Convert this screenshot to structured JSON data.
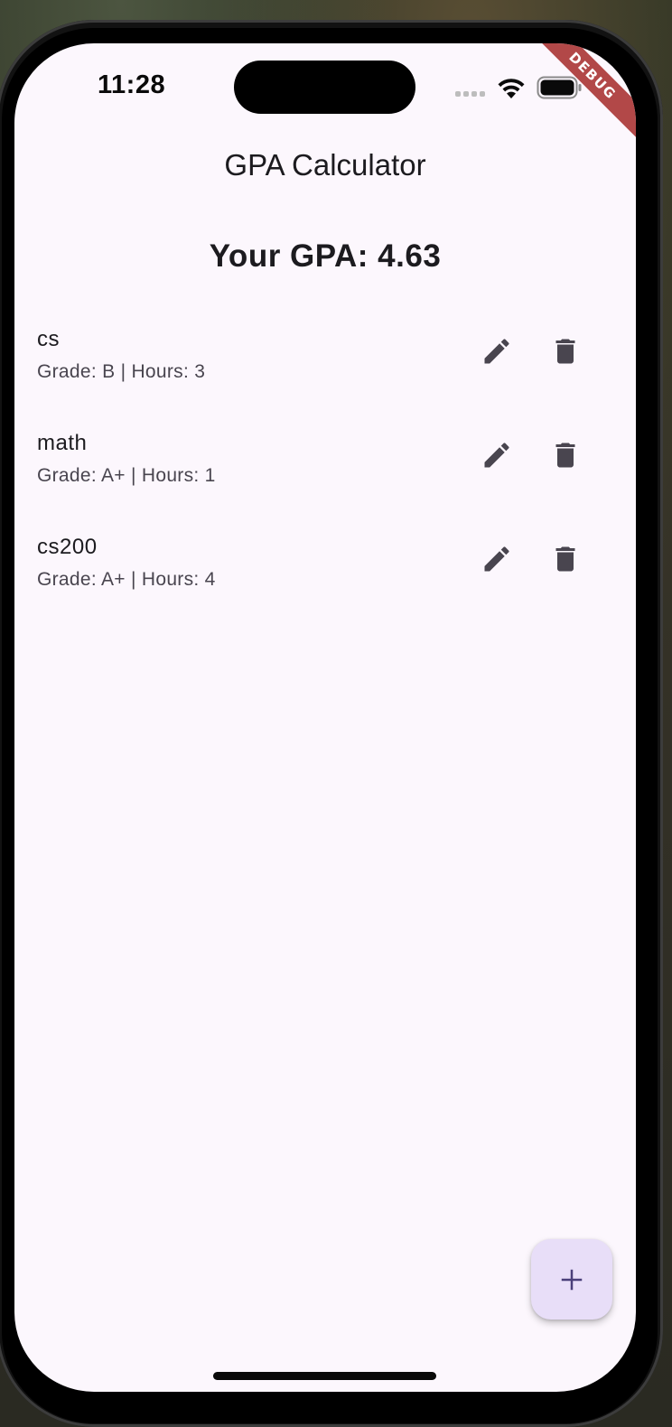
{
  "status_bar": {
    "time": "11:28"
  },
  "debug_banner": "DEBUG",
  "app_bar": {
    "title": "GPA Calculator"
  },
  "gpa_summary": "Your GPA: 4.63",
  "courses": [
    {
      "name": "cs",
      "detail": "Grade: B | Hours: 3"
    },
    {
      "name": "math",
      "detail": "Grade: A+ | Hours: 1"
    },
    {
      "name": "cs200",
      "detail": "Grade: A+ | Hours: 4"
    }
  ],
  "icons": {
    "edit": "edit-icon",
    "delete": "delete-icon",
    "add": "add-icon"
  },
  "colors": {
    "background": "#fcf7fd",
    "fab": "#e8def8",
    "fab_icon": "#4a3f7a",
    "icon": "#49454f",
    "debug_banner": "#b24848"
  }
}
